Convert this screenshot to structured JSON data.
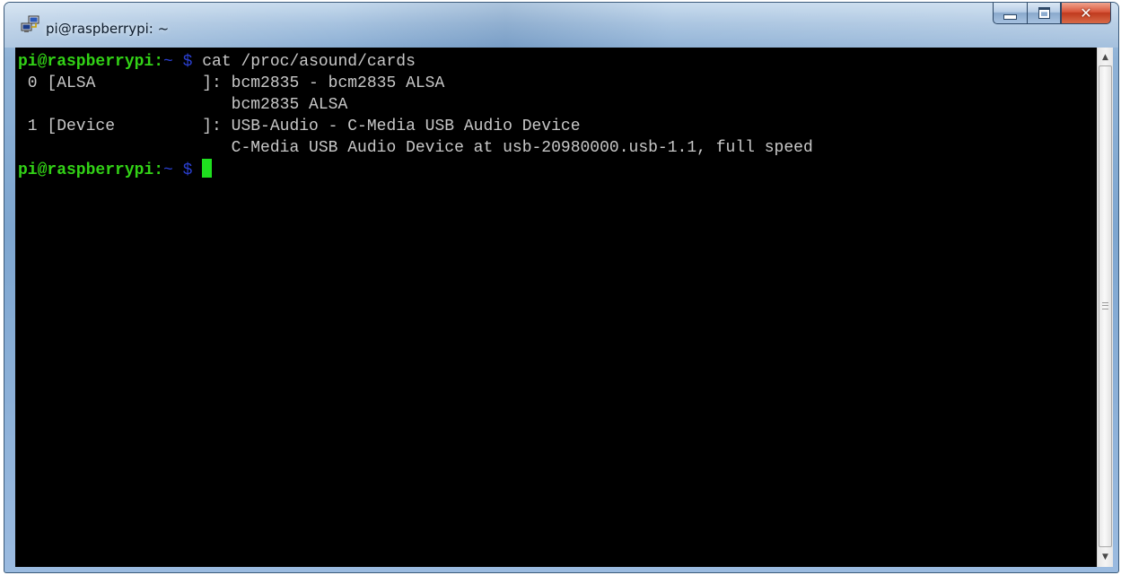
{
  "window": {
    "title": "pi@raspberrypi: ~",
    "icon": "putty-network-icon",
    "buttons": {
      "minimize": "minimize-icon",
      "maximize": "maximize-icon",
      "close": "close-icon"
    }
  },
  "terminal": {
    "colors": {
      "background": "#000000",
      "foreground": "#c8c8c8",
      "prompt": "#32d216",
      "path": "#2a3fd0",
      "cursor": "#1fe01f"
    },
    "prompt_user_host": "pi@raspberrypi:",
    "prompt_path": "~ $",
    "command": "cat /proc/asound/cards",
    "output": [
      " 0 [ALSA           ]: bcm2835 - bcm2835 ALSA",
      "                      bcm2835 ALSA",
      " 1 [Device         ]: USB-Audio - C-Media USB Audio Device",
      "                      C-Media USB Audio Device at usb-20980000.usb-1.1, full speed"
    ]
  },
  "scrollbar": {
    "up_arrow": "▲",
    "down_arrow": "▼"
  }
}
